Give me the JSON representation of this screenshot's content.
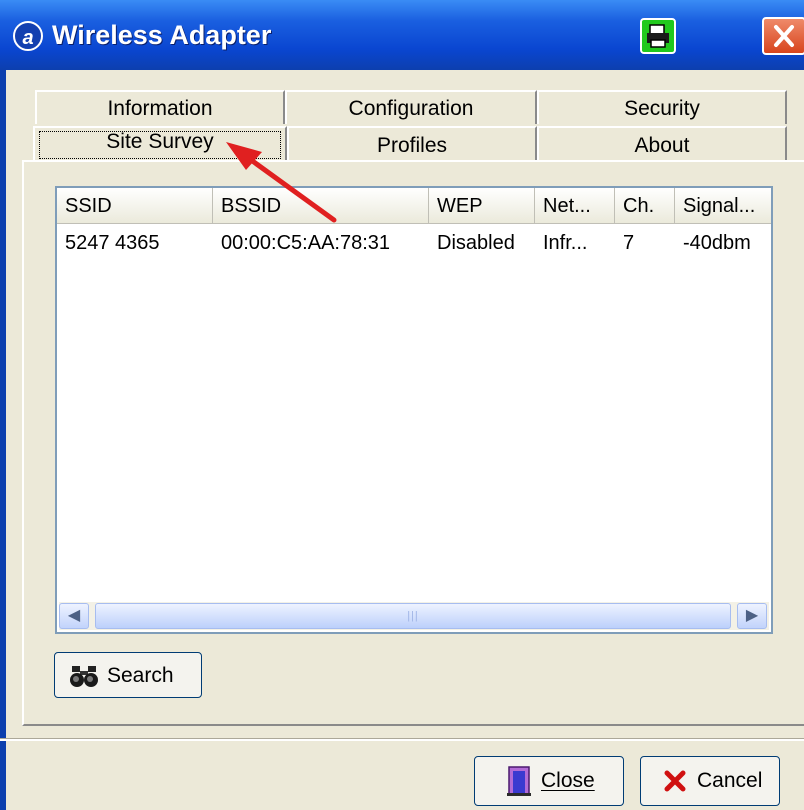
{
  "window": {
    "title": "Wireless Adapter",
    "icon": "wireless-logo-icon",
    "accent_color": "#0a46d1"
  },
  "tabs": {
    "row1": [
      "Information",
      "Configuration",
      "Security"
    ],
    "row2": [
      "Site Survey",
      "Profiles",
      "About"
    ],
    "active": "Site Survey"
  },
  "site_survey": {
    "columns": [
      "SSID",
      "BSSID",
      "WEP",
      "Net...",
      "Ch.",
      "Signal..."
    ],
    "rows": [
      [
        "5247 4365",
        "00:00:C5:AA:78:31",
        "Disabled",
        "Infr...",
        "7",
        "-40dbm"
      ]
    ],
    "search_label": "Search"
  },
  "footer": {
    "close_label": "Close",
    "cancel_label": "Cancel"
  },
  "annotation": {
    "arrow_color": "#e02020"
  }
}
